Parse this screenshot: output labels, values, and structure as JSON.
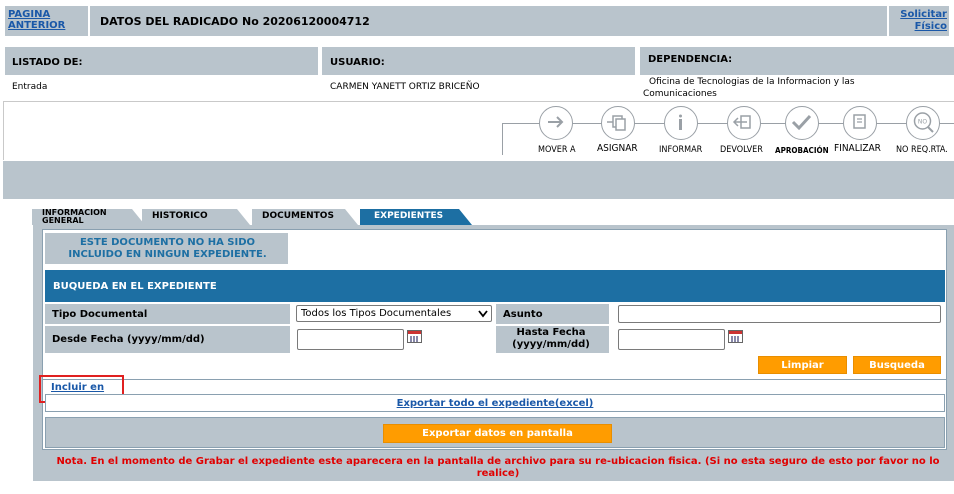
{
  "header": {
    "back_link": "PAGINA ANTERIOR",
    "title": "DATOS DEL RADICADO No 20206120004712",
    "physical_link": "Solicitar Físico"
  },
  "info": {
    "listado_label": "LISTADO DE:",
    "listado_value": "Entrada",
    "usuario_label": "USUARIO:",
    "usuario_value": "CARMEN YANETT ORTIZ BRICEÑO",
    "dependencia_label": "DEPENDENCIA:",
    "dependencia_value": "Oficina de Tecnologias de la Informacion y las Comunicaciones"
  },
  "actions": [
    {
      "label": "MOVER A",
      "icon": "arrow-right-icon"
    },
    {
      "label": "ASIGNAR",
      "icon": "assign-documents-icon"
    },
    {
      "label": "INFORMAR",
      "icon": "info-icon"
    },
    {
      "label": "DEVOLVER",
      "icon": "return-icon"
    },
    {
      "label": "APROBACIÓN",
      "icon": "checkmark-icon"
    },
    {
      "label": "FINALIZAR",
      "icon": "finalize-icon"
    },
    {
      "label": "NO REQ.RTA.",
      "icon": "no-reply-icon"
    }
  ],
  "tabs": [
    {
      "label": "INFORMACION GENERAL",
      "active": false
    },
    {
      "label": "HISTORICO",
      "active": false
    },
    {
      "label": "DOCUMENTOS",
      "active": false
    },
    {
      "label": "EXPEDIENTES",
      "active": true
    }
  ],
  "notice": "ESTE DOCUMENTO NO HA SIDO INCLUIDO EN NINGUN EXPEDIENTE.",
  "search": {
    "title": "BUQUEDA EN EL EXPEDIENTE",
    "tipo_label": "Tipo Documental",
    "tipo_selected": "Todos los Tipos Documentales",
    "asunto_label": "Asunto",
    "asunto_value": "",
    "desde_label": "Desde Fecha (yyyy/mm/dd)",
    "desde_value": "",
    "hasta_label": "Hasta Fecha (yyyy/mm/dd)",
    "hasta_value": "",
    "clear_button": "Limpiar",
    "search_button": "Busqueda"
  },
  "links": {
    "incluir": "Incluir en",
    "export_all": "Exportar todo el expediente(excel)"
  },
  "export_screen_button": "Exportar datos en pantalla",
  "note": "Nota. En el momento de Grabar el expediente este aparecera en la pantalla de archivo para su re-ubicacion fisica. (Si no esta seguro de esto por favor no lo realice)",
  "colors": {
    "grey_panel": "#b9c4cc",
    "blue_header": "#1d6fa3",
    "orange_button": "#ff9c00",
    "link": "#1a58a8",
    "note_red": "#e00000",
    "highlight_red": "#e02020"
  }
}
